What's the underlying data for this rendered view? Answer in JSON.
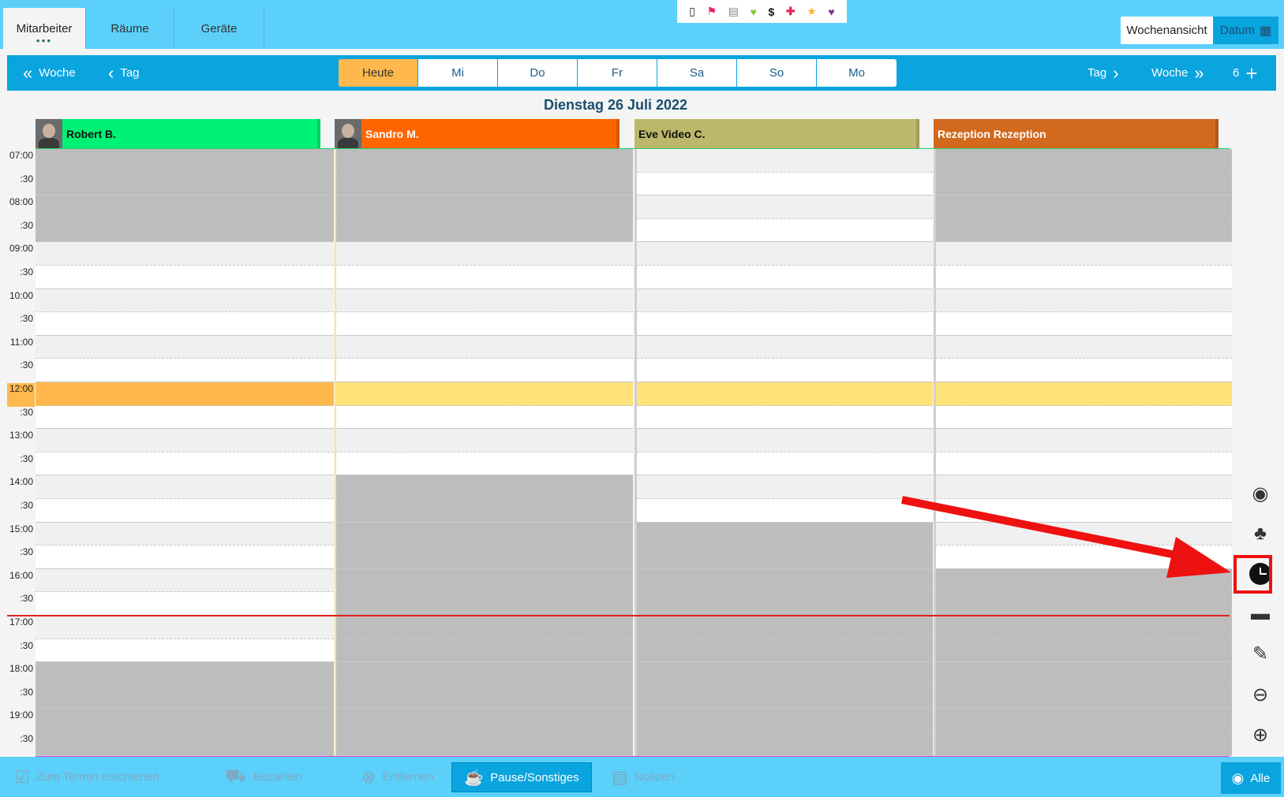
{
  "tabs": [
    {
      "label": "Mitarbeiter",
      "active": true
    },
    {
      "label": "Räume",
      "active": false
    },
    {
      "label": "Geräte",
      "active": false
    }
  ],
  "top_icons": [
    "phone-icon",
    "flag-icon",
    "clipboard-icon",
    "heart-icon",
    "dollar-icon",
    "cross-icon",
    "star-icon",
    "broken-heart-icon"
  ],
  "view": {
    "week_label": "Wochenansicht",
    "date_label": "Datum"
  },
  "nav": {
    "prev_week": "Woche",
    "prev_day": "Tag",
    "next_day": "Tag",
    "next_week": "Woche",
    "count": "6"
  },
  "day_tabs": [
    "Heute",
    "Mi",
    "Do",
    "Fr",
    "Sa",
    "So",
    "Mo"
  ],
  "date_title": "Dienstag 26 Juli 2022",
  "columns": [
    {
      "name": "Robert B.",
      "color": "#00f275",
      "text_color": "#111111",
      "avatar": true
    },
    {
      "name": "Sandro M.",
      "color": "#ff6600",
      "text_color": "#ffffff",
      "avatar": true
    },
    {
      "name": "Eve Video C.",
      "color": "#bdb76b",
      "text_color": "#111111",
      "avatar": false
    },
    {
      "name": "Rezeption Rezeption",
      "color": "#d2691e",
      "text_color": "#ffffff",
      "avatar": false
    }
  ],
  "times": [
    "07:00",
    ":30",
    "08:00",
    ":30",
    "09:00",
    ":30",
    "10:00",
    ":30",
    "11:00",
    ":30",
    "12:00",
    ":30",
    "13:00",
    ":30",
    "14:00",
    ":30",
    "15:00",
    ":30",
    "16:00",
    ":30",
    "17:00",
    ":30",
    "18:00",
    ":30",
    "19:00",
    ":30"
  ],
  "bottom": {
    "attended": "Zum Termin erschienen",
    "pay": "Bezahlen",
    "remove": "Entfernen",
    "pause": "Pause/Sonstiges",
    "notes": "Notizen",
    "all": "Alle"
  }
}
